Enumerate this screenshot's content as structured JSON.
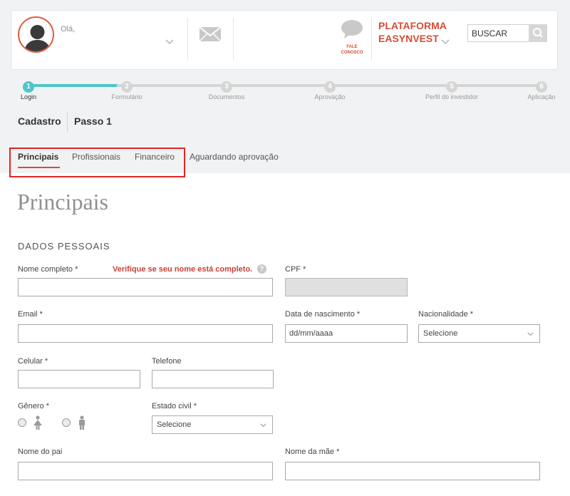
{
  "header": {
    "greeting": "Olá,",
    "chat_label_line1": "FALE",
    "chat_label_line2": "CONOSCO",
    "platform_line1": "PLATAFORMA",
    "platform_line2": "EASYNVEST",
    "search_placeholder": "BUSCAR"
  },
  "progress": {
    "steps": [
      {
        "number": "1",
        "label": "Login"
      },
      {
        "number": "2",
        "label": "Formulário"
      },
      {
        "number": "3",
        "label": "Documentos"
      },
      {
        "number": "4",
        "label": "Aprovação"
      },
      {
        "number": "5",
        "label": "Perfil do investidor"
      },
      {
        "number": "6",
        "label": "Aplicação"
      }
    ],
    "current_step": 1
  },
  "breadcrumb": {
    "section": "Cadastro",
    "step": "Passo 1"
  },
  "tabs": [
    "Principais",
    "Profissionais",
    "Financeiro",
    "Aguardando aprovação"
  ],
  "page_title": "Principais",
  "section_title": "DADOS PESSOAIS",
  "form": {
    "nome_completo_label": "Nome completo *",
    "nome_warning": "Verifique se seu nome está completo.",
    "help_glyph": "?",
    "cpf_label": "CPF *",
    "email_label": "Email *",
    "data_nascimento_label": "Data de nascimento *",
    "data_nascimento_placeholder": "dd/mm/aaaa",
    "nacionalidade_label": "Nacionalidade *",
    "nacionalidade_value": "Selecione",
    "celular_label": "Celular *",
    "telefone_label": "Telefone",
    "genero_label": "Gênero *",
    "estado_civil_label": "Estado civil *",
    "estado_civil_value": "Selecione",
    "nome_pai_label": "Nome do pai",
    "nome_mae_label": "Nome da mãe *"
  },
  "colors": {
    "accent": "#d44d36",
    "progress": "#4dc6c9",
    "highlight_box": "#e02525"
  }
}
